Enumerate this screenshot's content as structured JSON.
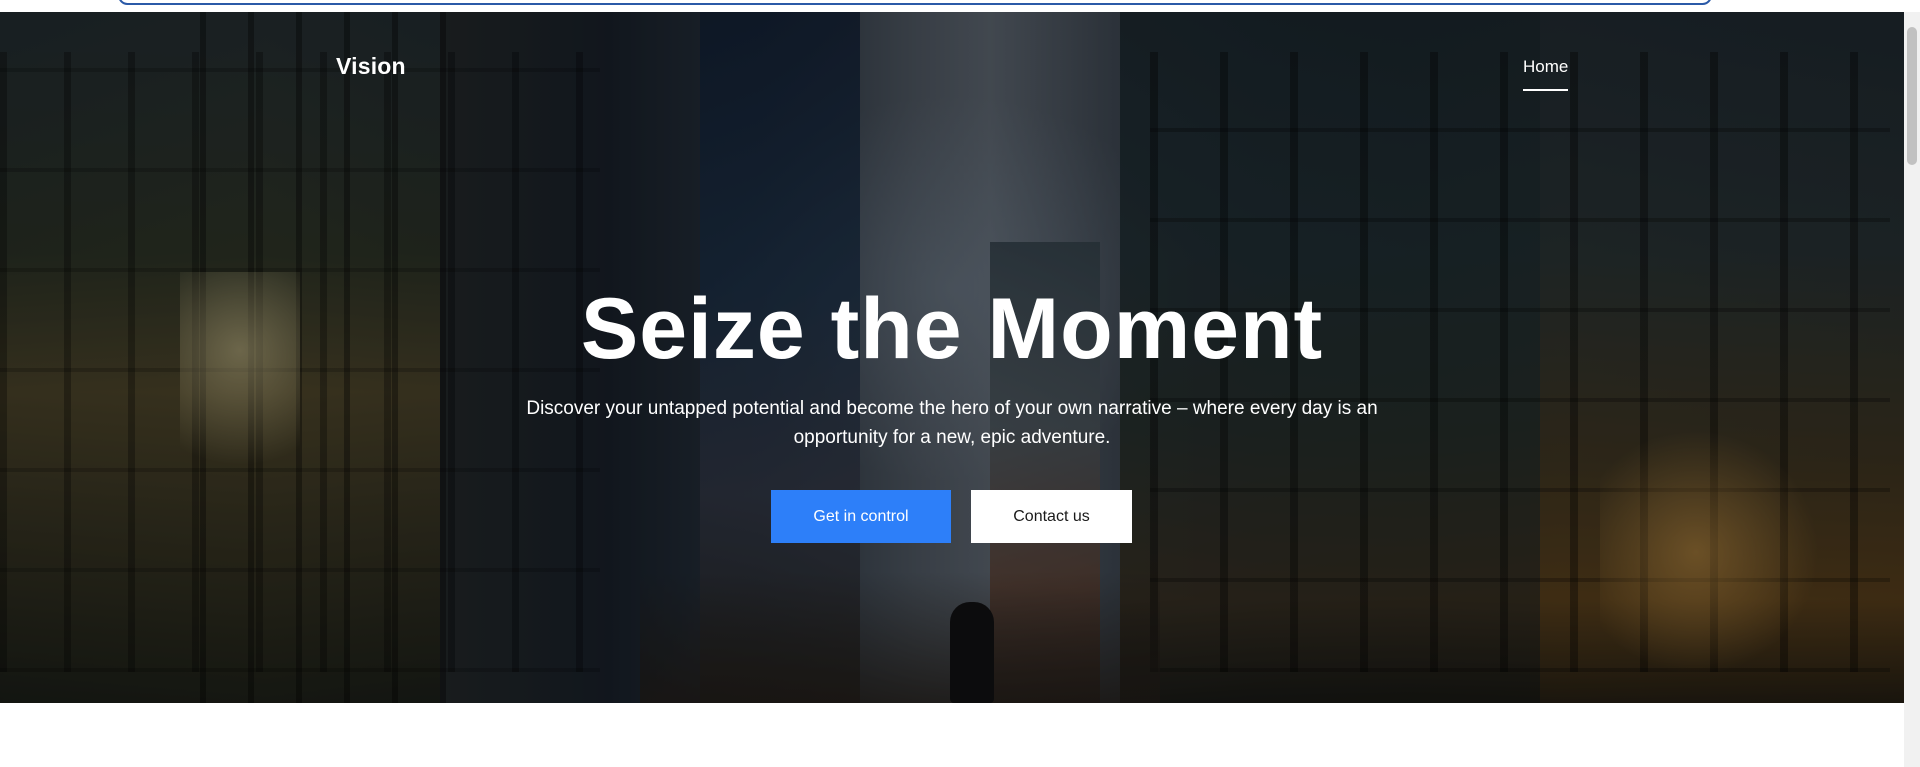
{
  "nav": {
    "brand": "Vision",
    "links": [
      {
        "label": "Home",
        "active": true
      }
    ]
  },
  "hero": {
    "headline": "Seize the Moment",
    "subtitle": "Discover your untapped potential and become the hero of your own narrative – where every day is an opportunity for a new, epic adventure.",
    "primary_cta": "Get in control",
    "secondary_cta": "Contact us"
  },
  "colors": {
    "primary_button": "#2d7ff9",
    "secondary_button": "#ffffff",
    "text_on_hero": "#ffffff"
  }
}
